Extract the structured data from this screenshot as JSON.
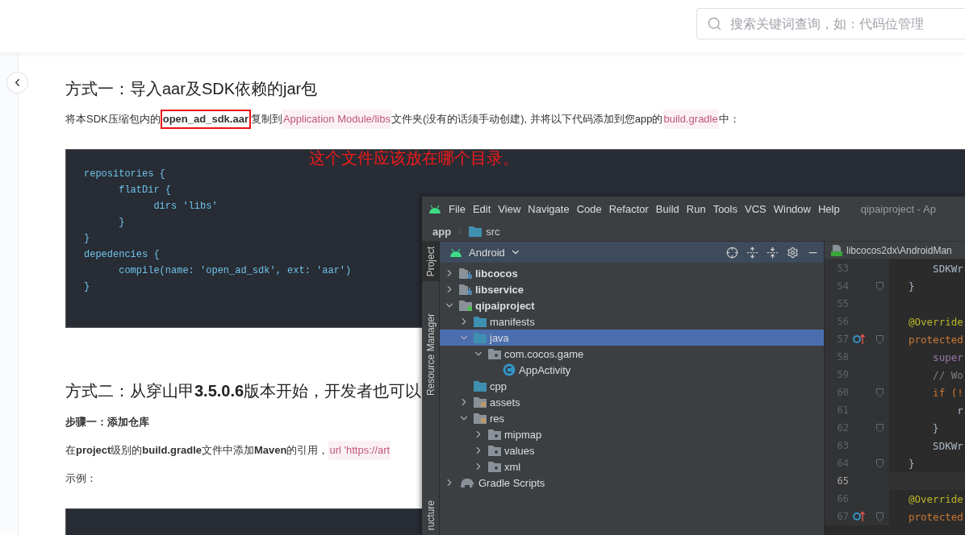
{
  "header": {
    "search": {
      "placeholder": "搜索关键词查询，如：代码位管理"
    }
  },
  "doc": [
    {
      "kind": "heading",
      "text": "方式一：导入aar及SDK依赖的jar包"
    },
    {
      "kind": "paragraph",
      "segments": [
        {
          "kind": "text",
          "text": "将本SDK压缩包内的"
        },
        {
          "kind": "annotated",
          "text": "open_ad_sdk.aar"
        },
        {
          "kind": "text",
          "text": "复制到"
        },
        {
          "kind": "code",
          "text": "Application Module/libs"
        },
        {
          "kind": "text",
          "text": "文件夹(没有的话须手动创建), 并将以下代码添加到您app的"
        },
        {
          "kind": "code",
          "text": "build.gradle"
        },
        {
          "kind": "text",
          "text": "中："
        }
      ]
    },
    {
      "kind": "code",
      "annotation": "这个文件应该放在哪个目录。",
      "lines": [
        "repositories {",
        "      flatDir {",
        "            dirs 'libs'",
        "      }",
        "}",
        "depedencies {",
        "      compile(name: 'open_ad_sdk', ext: 'aar')",
        "}"
      ]
    },
    {
      "kind": "heading",
      "text": "方式二：从穿山甲**3.5.0.6**版本开始，开发者也可以"
    },
    {
      "kind": "subheading",
      "text": "步骤一：添加仓库"
    },
    {
      "kind": "paragraph",
      "segments": [
        {
          "kind": "text",
          "text": "在**project**级别的**build.gradle**文件中添加**Maven**的引用，"
        },
        {
          "kind": "code",
          "text": "url 'https://art"
        }
      ]
    },
    {
      "kind": "paragraph",
      "segments": [
        {
          "kind": "text",
          "text": "示例："
        }
      ]
    },
    {
      "kind": "code"
    }
  ],
  "ide": {
    "menu": [
      "File",
      "Edit",
      "View",
      "Navigate",
      "Code",
      "Refactor",
      "Build",
      "Run",
      "Tools",
      "VCS",
      "Window",
      "Help"
    ],
    "title": "qipaiproject - Ap",
    "breadcrumb": [
      {
        "kind": "module",
        "text": "app"
      },
      {
        "kind": "folder",
        "text": "src"
      }
    ],
    "tool_tabs": [
      {
        "text": "Project",
        "selected": true
      },
      {
        "text": "Resource Manager",
        "selected": false
      },
      {
        "text": "ructure",
        "selected": false
      }
    ],
    "project_panel": {
      "view": "Android",
      "tree": [
        {
          "kind": "module",
          "text": "libcocos",
          "expanded": false,
          "selected": false
        },
        {
          "kind": "module",
          "text": "libservice",
          "expanded": false,
          "selected": false
        },
        {
          "kind": "app",
          "text": "qipaiproject",
          "expanded": true,
          "selected": false,
          "children": [
            {
              "kind": "folder",
              "text": "manifests",
              "expanded": false,
              "selected": false
            },
            {
              "kind": "folder",
              "text": "java",
              "expanded": true,
              "selected": true,
              "children": [
                {
                  "kind": "package",
                  "text": "com.cocos.game",
                  "expanded": true,
                  "selected": false,
                  "children": [
                    {
                      "kind": "class",
                      "text": "AppActivity",
                      "selected": false
                    }
                  ]
                }
              ]
            },
            {
              "kind": "folder",
              "text": "cpp",
              "selected": false
            },
            {
              "kind": "resources",
              "text": "assets",
              "expanded": false,
              "selected": false
            },
            {
              "kind": "resources",
              "text": "res",
              "expanded": true,
              "selected": false,
              "children": [
                {
                  "kind": "package",
                  "text": "mipmap",
                  "expanded": false,
                  "selected": false
                },
                {
                  "kind": "package",
                  "text": "values",
                  "expanded": false,
                  "selected": false
                },
                {
                  "kind": "package",
                  "text": "xml",
                  "expanded": false,
                  "selected": false
                }
              ]
            }
          ]
        },
        {
          "kind": "gradle",
          "text": "Gradle Scripts",
          "expanded": false,
          "selected": false
        }
      ]
    },
    "editor": {
      "tab": "libcocos2dx\\AndroidMan",
      "lines": [
        {
          "number": "53",
          "kind": "plain",
          "text": "    SDKWr",
          "override": false,
          "fold": false,
          "current": false
        },
        {
          "number": "54",
          "kind": "plain",
          "text": "}",
          "override": false,
          "fold": true,
          "current": false
        },
        {
          "number": "55",
          "override": false,
          "fold": false,
          "current": false
        },
        {
          "number": "56",
          "kind": "annotation",
          "text": "@Override",
          "override": false,
          "fold": false,
          "current": false
        },
        {
          "number": "57",
          "kind": "keyword",
          "text": "protected",
          "override": true,
          "fold": true,
          "current": false
        },
        {
          "number": "58",
          "kind": "member",
          "text": "    super",
          "override": false,
          "fold": false,
          "current": false
        },
        {
          "number": "59",
          "kind": "comment",
          "text": "    // Wo",
          "override": false,
          "fold": false,
          "current": false
        },
        {
          "number": "60",
          "kind": "keyword",
          "text": "    if (!",
          "override": false,
          "fold": true,
          "current": false
        },
        {
          "number": "61",
          "kind": "plain",
          "text": "        r",
          "override": false,
          "fold": false,
          "current": false
        },
        {
          "number": "62",
          "kind": "plain",
          "text": "    }",
          "override": false,
          "fold": true,
          "current": false
        },
        {
          "number": "63",
          "kind": "plain",
          "text": "    SDKWr",
          "override": false,
          "fold": false,
          "current": false
        },
        {
          "number": "64",
          "kind": "plain",
          "text": "}",
          "override": false,
          "fold": true,
          "current": false
        },
        {
          "number": "65",
          "override": false,
          "fold": false,
          "current": true
        },
        {
          "number": "66",
          "kind": "annotation",
          "text": "@Override",
          "override": false,
          "fold": false,
          "current": false
        },
        {
          "number": "67",
          "kind": "keyword",
          "text": "protected",
          "override": true,
          "fold": true,
          "current": false
        }
      ]
    }
  }
}
